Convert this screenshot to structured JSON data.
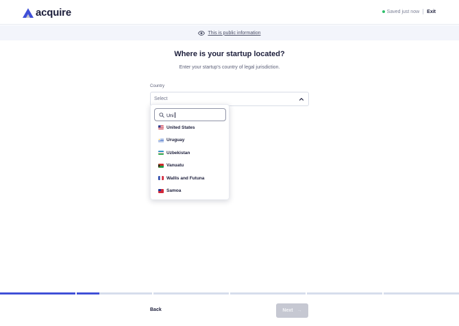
{
  "header": {
    "brand": "acquire",
    "save_status": "Saved just now",
    "exit_label": "Exit",
    "brand_color": "#3f4fd7",
    "status_color": "#2fbf6b"
  },
  "banner": {
    "icon": "eye-icon",
    "text": "This is public information"
  },
  "main": {
    "title": "Where is your startup located?",
    "subtitle": "Enter your startup's country of legal jurisdiction."
  },
  "country_field": {
    "label": "Country",
    "value": "Select",
    "icon": "chevron-up-icon",
    "dropdown": {
      "search_value": "Uni",
      "search_icon": "search-icon",
      "options": [
        {
          "label": "United States",
          "flag": "us-flag-icon"
        },
        {
          "label": "Uruguay",
          "flag": "uy-flag-icon"
        },
        {
          "label": "Uzbekistan",
          "flag": "uz-flag-icon"
        },
        {
          "label": "Vanuatu",
          "flag": "vu-flag-icon"
        },
        {
          "label": "Wallis and Futuna",
          "flag": "wf-flag-icon"
        },
        {
          "label": "Samoa",
          "flag": "ws-flag-icon"
        }
      ]
    }
  },
  "progress": {
    "total_steps": 6,
    "completed_fraction": 0.216
  },
  "footer": {
    "back_label": "Back",
    "next_label": "Next",
    "next_icon": "arrow-right-icon"
  }
}
